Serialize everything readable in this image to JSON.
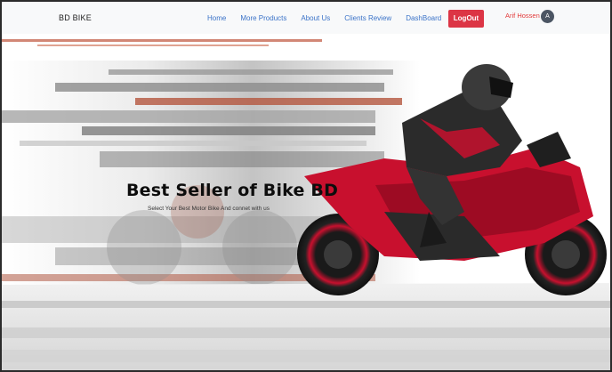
{
  "navbar": {
    "brand": "BD BIKE",
    "links": [
      "Home",
      "More Products",
      "About Us",
      "Clients Review",
      "DashBoard"
    ],
    "logout_label": "LogOut",
    "user_name": "Arif Hossen",
    "avatar_initial": "A"
  },
  "hero": {
    "title": "Best Seller of Bike BD",
    "subtitle": "Select Your Best Motor Bike And connet with us"
  },
  "colors": {
    "logout_bg": "#dc3545",
    "nav_link": "#3b73c8",
    "user_name": "#e23a3a",
    "bike_red": "#c8102e"
  }
}
